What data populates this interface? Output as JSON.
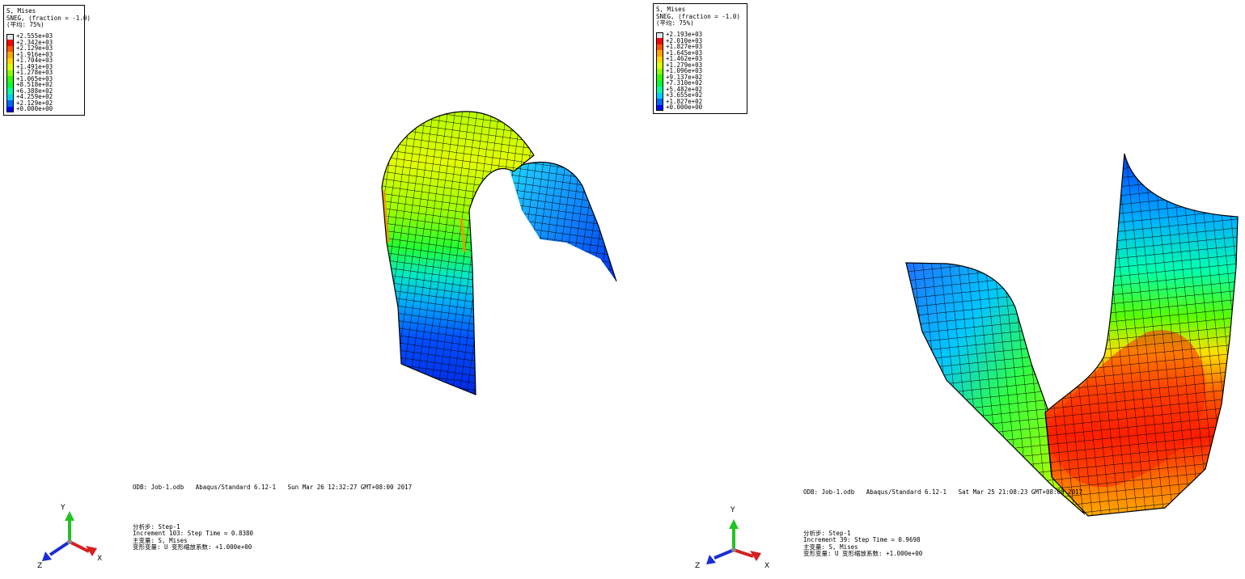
{
  "viewports": [
    {
      "legend": {
        "title": "S, Mises",
        "subtitle": "SNEG, (fraction = -1.0)",
        "avg": "(平均: 75%)",
        "values": [
          "+2.555e+03",
          "+2.342e+03",
          "+2.129e+03",
          "+1.916e+03",
          "+1.704e+03",
          "+1.491e+03",
          "+1.278e+03",
          "+1.065e+03",
          "+8.518e+02",
          "+6.388e+02",
          "+4.259e+02",
          "+2.129e+02",
          "+0.000e+00"
        ]
      },
      "odb": {
        "file": "ODB: Job-1.odb",
        "solver": "Abaqus/Standard 6.12-1",
        "date": "Sun Mar 26 12:32:27 GMT+08:00 2017"
      },
      "step": {
        "step_line": "分析步: Step-1",
        "increment_line": "Increment    103: Step Time =    0.8380",
        "primary_line": "主变量: S, Mises",
        "deform_line": "变形变量: U   变形缩放系数: +1.000e+00"
      },
      "triad": {
        "y": "Y",
        "x": "X",
        "z": "Z"
      }
    },
    {
      "legend": {
        "title": "S, Mises",
        "subtitle": "SNEG, (fraction = -1.0)",
        "avg": "(平均: 75%)",
        "values": [
          "+2.193e+03",
          "+2.010e+03",
          "+1.827e+03",
          "+1.645e+03",
          "+1.462e+03",
          "+1.279e+03",
          "+1.096e+03",
          "+9.137e+02",
          "+7.310e+02",
          "+5.482e+02",
          "+3.655e+02",
          "+1.827e+02",
          "+0.000e+00"
        ]
      },
      "odb": {
        "file": "ODB: Job-1.odb",
        "solver": "Abaqus/Standard 6.12-1",
        "date": "Sat Mar 25 21:08:23 GMT+08:00 2017"
      },
      "step": {
        "step_line": "分析步: Step-1",
        "increment_line": "Increment     39: Step Time =    0.9698",
        "primary_line": "主变量: S, Mises",
        "deform_line": "变形变量: U   变形缩放系数: +1.000e+00"
      },
      "triad": {
        "y": "Y",
        "x": "X",
        "z": "Z"
      }
    }
  ],
  "colors": {
    "contour": [
      "#dfe8ea",
      "#ff0000",
      "#ff5500",
      "#ffa500",
      "#ffd500",
      "#d9ff00",
      "#86ff00",
      "#2dff00",
      "#00ff36",
      "#00ffa0",
      "#00cdff",
      "#0064ff",
      "#0000ff",
      "#000000"
    ],
    "axis_y": "#22c322",
    "axis_x": "#d42020",
    "axis_z": "#1a2dd4"
  }
}
